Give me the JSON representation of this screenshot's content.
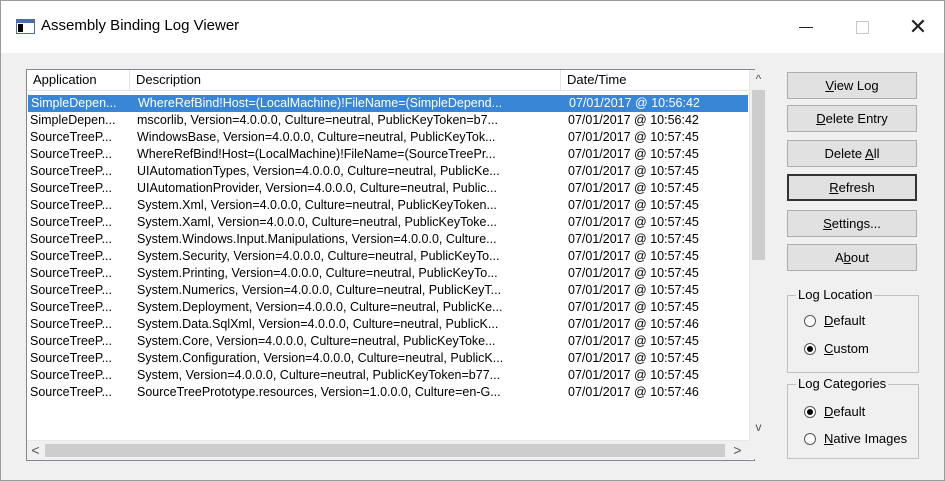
{
  "window": {
    "title": "Assembly Binding Log Viewer",
    "controls": {
      "minimize": "—",
      "maximize": "",
      "close": "✕"
    }
  },
  "list": {
    "columns": [
      "Application",
      "Description",
      "Date/Time"
    ],
    "rows": [
      {
        "app": "SimpleDepen...",
        "desc": "WhereRefBind!Host=(LocalMachine)!FileName=(SimpleDepend...",
        "time": "07/01/2017 @ 10:56:42"
      },
      {
        "app": "SimpleDepen...",
        "desc": "mscorlib, Version=4.0.0.0, Culture=neutral, PublicKeyToken=b7...",
        "time": "07/01/2017 @ 10:56:42"
      },
      {
        "app": "SourceTreeP...",
        "desc": "WindowsBase, Version=4.0.0.0, Culture=neutral, PublicKeyTok...",
        "time": "07/01/2017 @ 10:57:45"
      },
      {
        "app": "SourceTreeP...",
        "desc": "WhereRefBind!Host=(LocalMachine)!FileName=(SourceTreePr...",
        "time": "07/01/2017 @ 10:57:45"
      },
      {
        "app": "SourceTreeP...",
        "desc": "UIAutomationTypes, Version=4.0.0.0, Culture=neutral, PublicKe...",
        "time": "07/01/2017 @ 10:57:45"
      },
      {
        "app": "SourceTreeP...",
        "desc": "UIAutomationProvider, Version=4.0.0.0, Culture=neutral, Public...",
        "time": "07/01/2017 @ 10:57:45"
      },
      {
        "app": "SourceTreeP...",
        "desc": "System.Xml, Version=4.0.0.0, Culture=neutral, PublicKeyToken...",
        "time": "07/01/2017 @ 10:57:45"
      },
      {
        "app": "SourceTreeP...",
        "desc": "System.Xaml, Version=4.0.0.0, Culture=neutral, PublicKeyToke...",
        "time": "07/01/2017 @ 10:57:45"
      },
      {
        "app": "SourceTreeP...",
        "desc": "System.Windows.Input.Manipulations, Version=4.0.0.0, Culture...",
        "time": "07/01/2017 @ 10:57:45"
      },
      {
        "app": "SourceTreeP...",
        "desc": "System.Security, Version=4.0.0.0, Culture=neutral, PublicKeyTo...",
        "time": "07/01/2017 @ 10:57:45"
      },
      {
        "app": "SourceTreeP...",
        "desc": "System.Printing, Version=4.0.0.0, Culture=neutral, PublicKeyTo...",
        "time": "07/01/2017 @ 10:57:45"
      },
      {
        "app": "SourceTreeP...",
        "desc": "System.Numerics, Version=4.0.0.0, Culture=neutral, PublicKeyT...",
        "time": "07/01/2017 @ 10:57:45"
      },
      {
        "app": "SourceTreeP...",
        "desc": "System.Deployment, Version=4.0.0.0, Culture=neutral, PublicKe...",
        "time": "07/01/2017 @ 10:57:45"
      },
      {
        "app": "SourceTreeP...",
        "desc": "System.Data.SqlXml, Version=4.0.0.0, Culture=neutral, PublicK...",
        "time": "07/01/2017 @ 10:57:46"
      },
      {
        "app": "SourceTreeP...",
        "desc": "System.Core, Version=4.0.0.0, Culture=neutral, PublicKeyToke...",
        "time": "07/01/2017 @ 10:57:45"
      },
      {
        "app": "SourceTreeP...",
        "desc": "System.Configuration, Version=4.0.0.0, Culture=neutral, PublicK...",
        "time": "07/01/2017 @ 10:57:45"
      },
      {
        "app": "SourceTreeP...",
        "desc": "System, Version=4.0.0.0, Culture=neutral, PublicKeyToken=b77...",
        "time": "07/01/2017 @ 10:57:45"
      },
      {
        "app": "SourceTreeP...",
        "desc": "SourceTreePrototype.resources, Version=1.0.0.0, Culture=en-G...",
        "time": "07/01/2017 @ 10:57:46"
      }
    ],
    "selected_index": 0
  },
  "buttons": {
    "view_log": {
      "pre": "",
      "key": "V",
      "post": "iew Log"
    },
    "delete_entry": {
      "pre": "",
      "key": "D",
      "post": "elete Entry"
    },
    "delete_all": {
      "pre": "Delete ",
      "key": "A",
      "post": "ll"
    },
    "refresh": {
      "pre": "",
      "key": "R",
      "post": "efresh"
    },
    "settings": {
      "pre": "",
      "key": "S",
      "post": "ettings..."
    },
    "about": {
      "pre": "A",
      "key": "b",
      "post": "out"
    }
  },
  "log_location": {
    "label": "Log Location",
    "options": [
      {
        "pre": "",
        "key": "D",
        "post": "efault",
        "checked": false
      },
      {
        "pre": "",
        "key": "C",
        "post": "ustom",
        "checked": true
      }
    ]
  },
  "log_categories": {
    "label": "Log Categories",
    "options": [
      {
        "pre": "",
        "key": "D",
        "post": "efault",
        "checked": true
      },
      {
        "pre": "",
        "key": "N",
        "post": "ative Images",
        "checked": false
      }
    ]
  },
  "colors": {
    "selection": "#3a86d6",
    "window_bg": "#f0f0f0",
    "button_bg": "#e1e1e1"
  }
}
